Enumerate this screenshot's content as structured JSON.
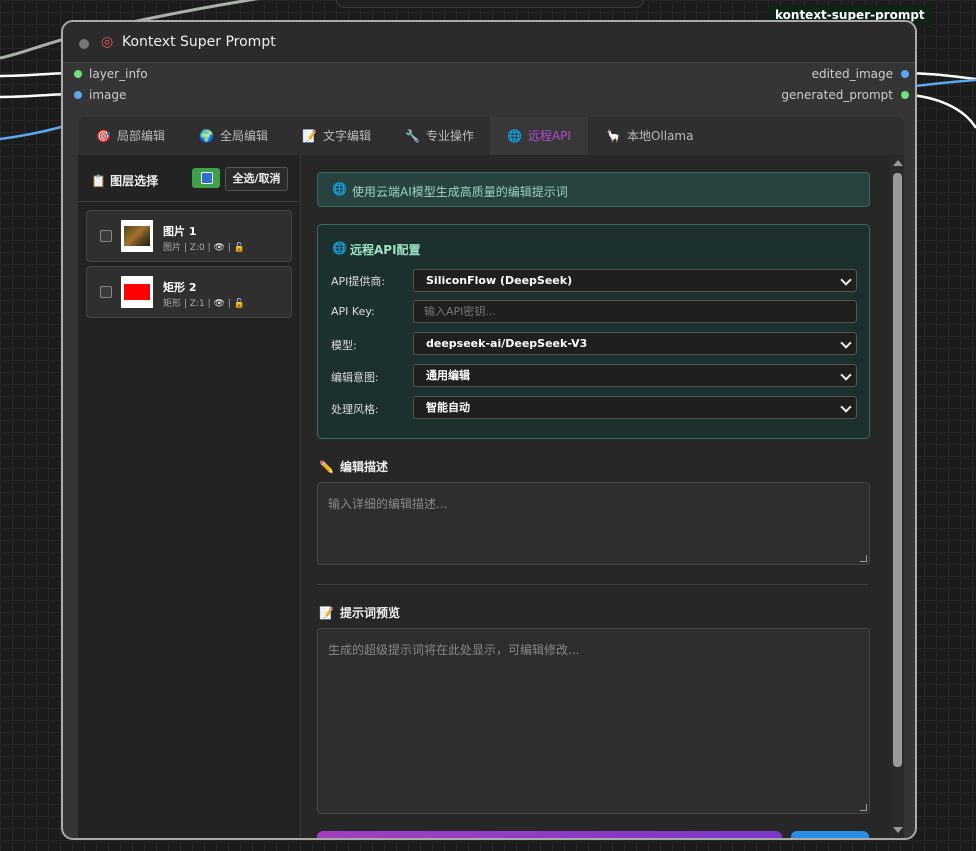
{
  "node": {
    "tag": "kontext-super-prompt",
    "title": "Kontext Super Prompt",
    "title_icon": "target-icon",
    "inputs": [
      "layer_info",
      "image"
    ],
    "outputs": [
      "edited_image",
      "generated_prompt"
    ]
  },
  "tabs": [
    {
      "icon": "🎯",
      "label": "局部编辑"
    },
    {
      "icon": "🌍",
      "label": "全局编辑"
    },
    {
      "icon": "📝",
      "label": "文字编辑"
    },
    {
      "icon": "🔧",
      "label": "专业操作"
    },
    {
      "icon": "🌐",
      "label": "远程API"
    },
    {
      "icon": "🦙",
      "label": "本地Ollama"
    }
  ],
  "active_tab": "远程API",
  "sidebar": {
    "icon": "📋",
    "title": "图层选择",
    "select_all_label": "全选/取消",
    "layers": [
      {
        "name": "图片 1",
        "type": "图片",
        "z": "Z:0",
        "eye": "👁",
        "lock": "🔓"
      },
      {
        "name": "矩形 2",
        "type": "矩形",
        "z": "Z:1",
        "eye": "👁",
        "lock": "🔓"
      }
    ]
  },
  "main": {
    "info_icon": "🌐",
    "info_text": "使用云端AI模型生成高质量的编辑提示词",
    "api_config": {
      "icon": "🌐",
      "title": "远程API配置",
      "provider_label": "API提供商:",
      "provider_value": "SiliconFlow (DeepSeek)",
      "key_label": "API Key:",
      "key_placeholder": "输入API密钥...",
      "model_label": "模型:",
      "model_value": "deepseek-ai/DeepSeek-V3",
      "intent_label": "编辑意图:",
      "intent_value": "通用编辑",
      "style_label": "处理风格:",
      "style_value": "智能自动"
    },
    "edit_desc": {
      "icon": "✏️",
      "title": "编辑描述",
      "placeholder": "输入详细的编辑描述..."
    },
    "preview": {
      "icon": "📝",
      "title": "提示词预览",
      "placeholder": "生成的超级提示词将在此处显示，可编辑修改..."
    }
  },
  "colors": {
    "accent_purple": "#9b2db8",
    "input_green": "#6fe07a",
    "input_blue": "#5aa9f0",
    "api_border": "#3a6a5e"
  }
}
